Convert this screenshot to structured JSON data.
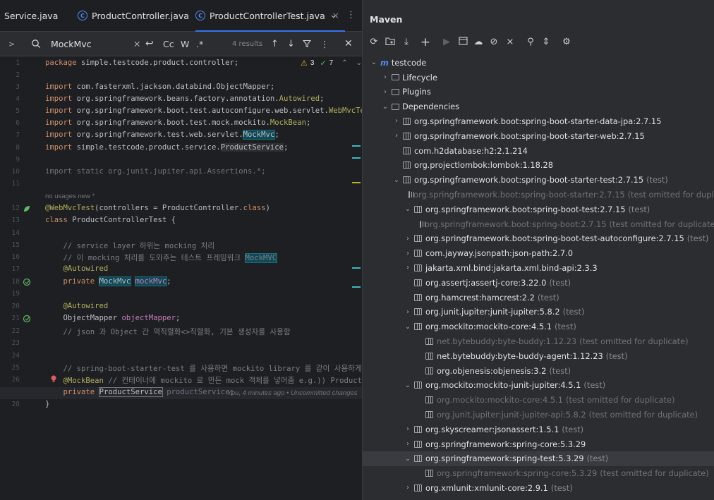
{
  "editor": {
    "tabs": [
      {
        "label": "Service.java"
      },
      {
        "label": "ProductController.java"
      },
      {
        "label": "ProductControllerTest.java",
        "close": "×"
      }
    ],
    "tab_more": "⌄",
    "tab_menu": "⋮",
    "search": {
      "query": "MockMvc",
      "results": "4 results",
      "case_label": "Cc",
      "word_label": "W",
      "regex_label": ".*"
    },
    "inspections": {
      "warnings": "3",
      "ok": "7"
    },
    "hints": {
      "usages": "no usages   new *"
    },
    "blame": "You, 4 minutes ago • Uncommitted changes"
  },
  "code_lines": [
    {
      "n": "1",
      "text": "package simple.testcode.product.controller;"
    },
    {
      "n": "2",
      "text": ""
    },
    {
      "n": "3",
      "text": "import com.fasterxml.jackson.databind.ObjectMapper;"
    },
    {
      "n": "4",
      "text": "import org.springframework.beans.factory.annotation.Autowired;"
    },
    {
      "n": "5",
      "text": "import org.springframework.boot.test.autoconfigure.web.servlet.WebMvcTest;"
    },
    {
      "n": "6",
      "text": "import org.springframework.boot.test.mock.mockito.MockBean;"
    },
    {
      "n": "7",
      "text": "import org.springframework.test.web.servlet.MockMvc;"
    },
    {
      "n": "8",
      "text": "import simple.testcode.product.service.ProductService;"
    },
    {
      "n": "9",
      "text": ""
    },
    {
      "n": "10",
      "text": "import static org.junit.jupiter.api.Assertions.*;"
    },
    {
      "n": "11",
      "text": ""
    },
    {
      "n": "12",
      "text": "@WebMvcTest(controllers = ProductController.class)"
    },
    {
      "n": "13",
      "text": "class ProductControllerTest {"
    },
    {
      "n": "14",
      "text": ""
    },
    {
      "n": "15",
      "text": "    // service layer 하위는 mocking 처리"
    },
    {
      "n": "16",
      "text": "    // 이 mocking 처리를 도와주는 테스트 프레임워크 MockMVC"
    },
    {
      "n": "17",
      "text": "    @Autowired"
    },
    {
      "n": "18",
      "text": "    private MockMvc mockMvc;"
    },
    {
      "n": "19",
      "text": ""
    },
    {
      "n": "20",
      "text": "    @Autowired"
    },
    {
      "n": "21",
      "text": "    ObjectMapper objectMapper;"
    },
    {
      "n": "22",
      "text": "    // json 과 Object 간 역직렬화<>직렬화, 기본 생성자를 사용함"
    },
    {
      "n": "23",
      "text": ""
    },
    {
      "n": "24",
      "text": ""
    },
    {
      "n": "25",
      "text": "    // spring-boot-starter-test 를 사용하면 mockito library 를 같이 사용하게됨"
    },
    {
      "n": "26",
      "text": "    @MockBean // 컨테이너에 mockito 로 만든 mock 객체를 넣어줌 e.g.)) ProductServiceMock"
    },
    {
      "n": "27",
      "text": "    private ProductService productService;"
    },
    {
      "n": "28",
      "text": "}"
    }
  ],
  "maven": {
    "title": "Maven",
    "project": "testcode",
    "tree": [
      {
        "label": "Lifecycle",
        "scope": "",
        "level": 1,
        "arrow": "›",
        "type": "folder",
        "dim": false
      },
      {
        "label": "Plugins",
        "scope": "",
        "level": 1,
        "arrow": "›",
        "type": "folder",
        "dim": false
      },
      {
        "label": "Dependencies",
        "scope": "",
        "level": 1,
        "arrow": "⌄",
        "type": "folder",
        "dim": false
      },
      {
        "label": "org.springframework.boot:spring-boot-starter-data-jpa:2.7.15",
        "scope": "",
        "level": 2,
        "arrow": "›",
        "type": "lib",
        "dim": false
      },
      {
        "label": "org.springframework.boot:spring-boot-starter-web:2.7.15",
        "scope": "",
        "level": 2,
        "arrow": "›",
        "type": "lib",
        "dim": false
      },
      {
        "label": "com.h2database:h2:2.1.214",
        "scope": "",
        "level": 2,
        "arrow": "",
        "type": "lib",
        "dim": false
      },
      {
        "label": "org.projectlombok:lombok:1.18.28",
        "scope": "",
        "level": 2,
        "arrow": "",
        "type": "lib",
        "dim": false
      },
      {
        "label": "org.springframework.boot:spring-boot-starter-test:2.7.15",
        "scope": "(test)",
        "level": 2,
        "arrow": "⌄",
        "type": "lib",
        "dim": false
      },
      {
        "label": "org.springframework.boot:spring-boot-starter:2.7.15",
        "scope": "(test omitted for duplicate)",
        "level": 3,
        "arrow": "",
        "type": "lib",
        "dim": true
      },
      {
        "label": "org.springframework.boot:spring-boot-test:2.7.15",
        "scope": "(test)",
        "level": 3,
        "arrow": "⌄",
        "type": "lib",
        "dim": false
      },
      {
        "label": "org.springframework.boot:spring-boot:2.7.15",
        "scope": "(test omitted for duplicate)",
        "level": 4,
        "arrow": "",
        "type": "lib",
        "dim": true
      },
      {
        "label": "org.springframework.boot:spring-boot-test-autoconfigure:2.7.15",
        "scope": "(test)",
        "level": 3,
        "arrow": "›",
        "type": "lib",
        "dim": false
      },
      {
        "label": "com.jayway.jsonpath:json-path:2.7.0",
        "scope": "",
        "level": 3,
        "arrow": "›",
        "type": "lib",
        "dim": false
      },
      {
        "label": "jakarta.xml.bind:jakarta.xml.bind-api:2.3.3",
        "scope": "",
        "level": 3,
        "arrow": "›",
        "type": "lib",
        "dim": false
      },
      {
        "label": "org.assertj:assertj-core:3.22.0",
        "scope": "(test)",
        "level": 3,
        "arrow": "",
        "type": "lib",
        "dim": false
      },
      {
        "label": "org.hamcrest:hamcrest:2.2",
        "scope": "(test)",
        "level": 3,
        "arrow": "",
        "type": "lib",
        "dim": false
      },
      {
        "label": "org.junit.jupiter:junit-jupiter:5.8.2",
        "scope": "(test)",
        "level": 3,
        "arrow": "›",
        "type": "lib",
        "dim": false
      },
      {
        "label": "org.mockito:mockito-core:4.5.1",
        "scope": "(test)",
        "level": 3,
        "arrow": "⌄",
        "type": "lib",
        "dim": false
      },
      {
        "label": "net.bytebuddy:byte-buddy:1.12.23",
        "scope": "(test omitted for duplicate)",
        "level": 4,
        "arrow": "",
        "type": "lib",
        "dim": true
      },
      {
        "label": "net.bytebuddy:byte-buddy-agent:1.12.23",
        "scope": "(test)",
        "level": 4,
        "arrow": "",
        "type": "lib",
        "dim": false
      },
      {
        "label": "org.objenesis:objenesis:3.2",
        "scope": "(test)",
        "level": 4,
        "arrow": "",
        "type": "lib",
        "dim": false
      },
      {
        "label": "org.mockito:mockito-junit-jupiter:4.5.1",
        "scope": "(test)",
        "level": 3,
        "arrow": "⌄",
        "type": "lib",
        "dim": false
      },
      {
        "label": "org.mockito:mockito-core:4.5.1",
        "scope": "(test omitted for duplicate)",
        "level": 4,
        "arrow": "",
        "type": "lib",
        "dim": true
      },
      {
        "label": "org.junit.jupiter:junit-jupiter-api:5.8.2",
        "scope": "(test omitted for duplicate)",
        "level": 4,
        "arrow": "",
        "type": "lib",
        "dim": true
      },
      {
        "label": "org.skyscreamer:jsonassert:1.5.1",
        "scope": "(test)",
        "level": 3,
        "arrow": "›",
        "type": "lib",
        "dim": false
      },
      {
        "label": "org.springframework:spring-core:5.3.29",
        "scope": "",
        "level": 3,
        "arrow": "›",
        "type": "lib",
        "dim": false
      },
      {
        "label": "org.springframework:spring-test:5.3.29",
        "scope": "(test)",
        "level": 3,
        "arrow": "⌄",
        "type": "lib",
        "dim": false,
        "selected": true
      },
      {
        "label": "org.springframework:spring-core:5.3.29",
        "scope": "(test omitted for duplicate)",
        "level": 4,
        "arrow": "",
        "type": "lib",
        "dim": true
      },
      {
        "label": "org.xmlunit:xmlunit-core:2.9.1",
        "scope": "(test)",
        "level": 3,
        "arrow": "›",
        "type": "lib",
        "dim": false
      }
    ]
  }
}
